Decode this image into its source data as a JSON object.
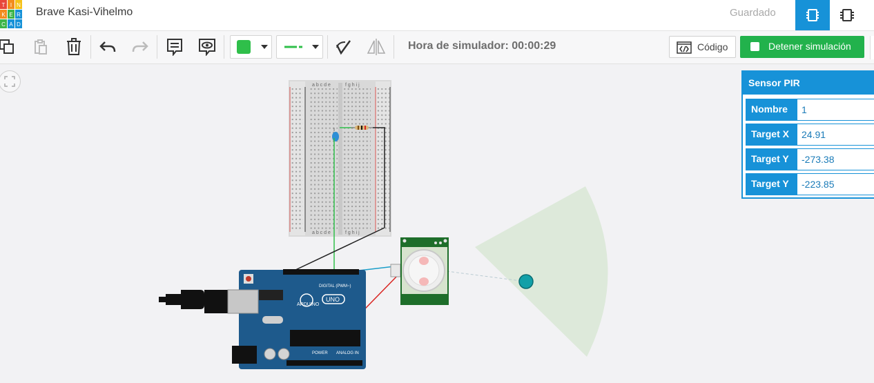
{
  "app": {
    "logo_letters": [
      "T",
      "I",
      "N",
      "K",
      "E",
      "R",
      "C",
      "A",
      "D"
    ],
    "project_title": "Brave Kasi-Vihelmo",
    "save_status": "Guardado"
  },
  "toolbar": {
    "simulator_time_label": "Hora de simulador: 00:00:29",
    "code_label": "Código",
    "stop_label": "Detener simulación",
    "fill_color": "#2fbf4a",
    "wire_color": "#2fbf4a"
  },
  "panel": {
    "title": "Sensor PIR",
    "rows": [
      {
        "label": "Nombre",
        "value": "1"
      },
      {
        "label": "Target X",
        "value": "24.91"
      },
      {
        "label": "Target Y",
        "value": "-273.38"
      },
      {
        "label": "Target Y",
        "value": "-223.85"
      }
    ]
  },
  "breadboard": {
    "columns_left": "a b c d e",
    "columns_right": "f g h i j"
  },
  "arduino": {
    "brand": "ARDUINO",
    "model": "UNO",
    "digital_label": "DIGITAL (PWM~)",
    "power_label": "POWER",
    "analog_label": "ANALOG IN"
  },
  "colors": {
    "accent": "#1792d8",
    "stop_button": "#22b24c",
    "pir_board": "#1e6e2a",
    "arduino_board": "#1e5a8c",
    "detection_zone": "#dce9d9",
    "target": "#12a0a8"
  }
}
